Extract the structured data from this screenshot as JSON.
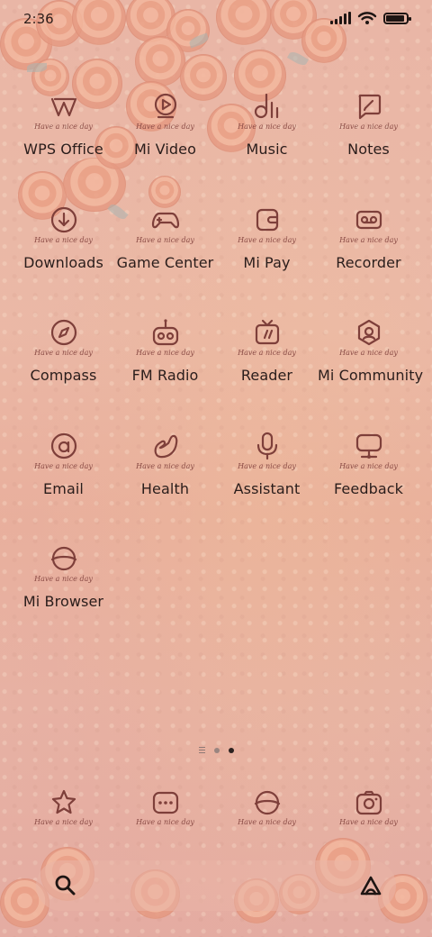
{
  "status_bar": {
    "time": "2:36",
    "battery_level": 0.9
  },
  "tagline": "Have a nice day",
  "apps": [
    {
      "label": "WPS Office",
      "icon": "wps-icon"
    },
    {
      "label": "Mi Video",
      "icon": "video-play-icon"
    },
    {
      "label": "Music",
      "icon": "music-note-icon"
    },
    {
      "label": "Notes",
      "icon": "notes-pen-icon"
    },
    {
      "label": "Downloads",
      "icon": "download-arrow-icon"
    },
    {
      "label": "Game Center",
      "icon": "gamepad-icon"
    },
    {
      "label": "Mi Pay",
      "icon": "wallet-icon"
    },
    {
      "label": "Recorder",
      "icon": "recorder-icon"
    },
    {
      "label": "Compass",
      "icon": "compass-icon"
    },
    {
      "label": "FM Radio",
      "icon": "radio-icon"
    },
    {
      "label": "Reader",
      "icon": "reader-icon"
    },
    {
      "label": "Mi Community",
      "icon": "community-hexagon-icon"
    },
    {
      "label": "Email",
      "icon": "email-at-icon"
    },
    {
      "label": "Health",
      "icon": "health-arm-icon"
    },
    {
      "label": "Assistant",
      "icon": "microphone-icon"
    },
    {
      "label": "Feedback",
      "icon": "feedback-monitor-icon"
    },
    {
      "label": "Mi Browser",
      "icon": "browser-planet-icon"
    }
  ],
  "page_indicator": {
    "pages": 2,
    "active_page": 2
  },
  "dock": [
    {
      "icon": "star-icon"
    },
    {
      "icon": "messages-icon"
    },
    {
      "icon": "browser-planet-icon"
    },
    {
      "icon": "camera-icon"
    }
  ],
  "search_bar": {
    "left_icon": "search-icon",
    "right_icon": "assistant-a-icon"
  },
  "colors": {
    "icon_stroke": "#7e3f3a",
    "text": "#2a1d1b",
    "background": "#e9b6a6"
  }
}
